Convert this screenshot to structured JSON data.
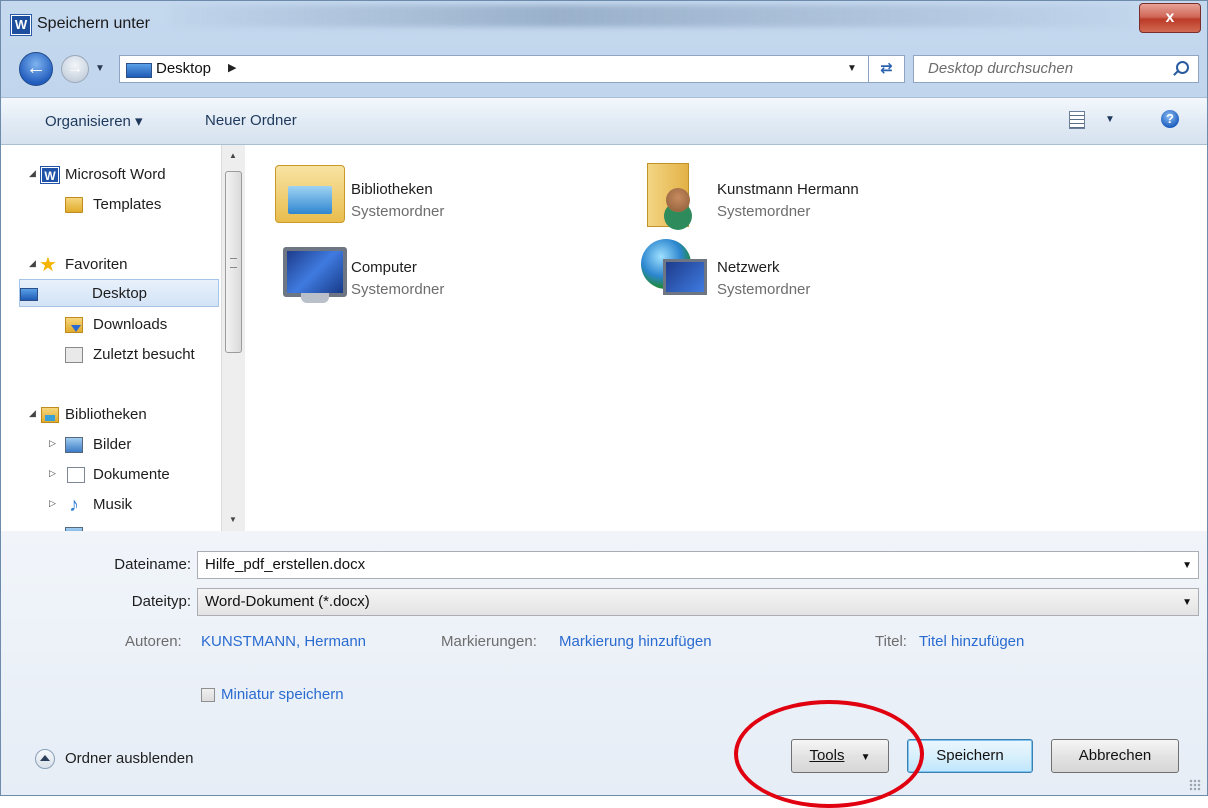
{
  "window": {
    "title": "Speichern unter",
    "app_icon": "word-icon",
    "close_label": "x"
  },
  "address": {
    "location": "Desktop",
    "search_placeholder": "Desktop durchsuchen"
  },
  "toolbar": {
    "organize": "Organisieren ▾",
    "new_folder": "Neuer Ordner"
  },
  "nav": {
    "items": [
      {
        "label": "Microsoft Word",
        "icon": "word-icon"
      },
      {
        "label": "Templates",
        "icon": "folder-icon"
      },
      {
        "label": "Favoriten",
        "icon": "star-icon"
      },
      {
        "label": "Desktop",
        "icon": "desktop-icon",
        "selected": true
      },
      {
        "label": "Downloads",
        "icon": "downloads-icon"
      },
      {
        "label": "Zuletzt besucht",
        "icon": "recent-places-icon"
      },
      {
        "label": "Bibliotheken",
        "icon": "libraries-icon"
      },
      {
        "label": "Bilder",
        "icon": "pictures-icon"
      },
      {
        "label": "Dokumente",
        "icon": "documents-icon"
      },
      {
        "label": "Musik",
        "icon": "music-icon"
      }
    ]
  },
  "content": {
    "items": [
      {
        "name": "Bibliotheken",
        "type": "Systemordner",
        "icon": "libraries-icon"
      },
      {
        "name": "Kunstmann Hermann",
        "type": "Systemordner",
        "icon": "user-folder-icon"
      },
      {
        "name": "Computer",
        "type": "Systemordner",
        "icon": "computer-icon"
      },
      {
        "name": "Netzwerk",
        "type": "Systemordner",
        "icon": "network-icon"
      }
    ]
  },
  "form": {
    "filename_label": "Dateiname:",
    "filename_value": "Hilfe_pdf_erstellen.docx",
    "filetype_label": "Dateityp:",
    "filetype_value": "Word-Dokument (*.docx)",
    "authors_label": "Autoren:",
    "authors_value": "KUNSTMANN, Hermann",
    "tags_label": "Markierungen:",
    "tags_value": "Markierung hinzufügen",
    "title_label": "Titel:",
    "title_value": "Titel hinzufügen",
    "thumbnail_label": "Miniatur speichern"
  },
  "footer": {
    "hide_folders": "Ordner ausblenden",
    "tools": "Tools",
    "save": "Speichern",
    "cancel": "Abbrechen"
  },
  "colors": {
    "annotation_ellipse": "#e00010",
    "link_blue": "#2a6bd0"
  }
}
